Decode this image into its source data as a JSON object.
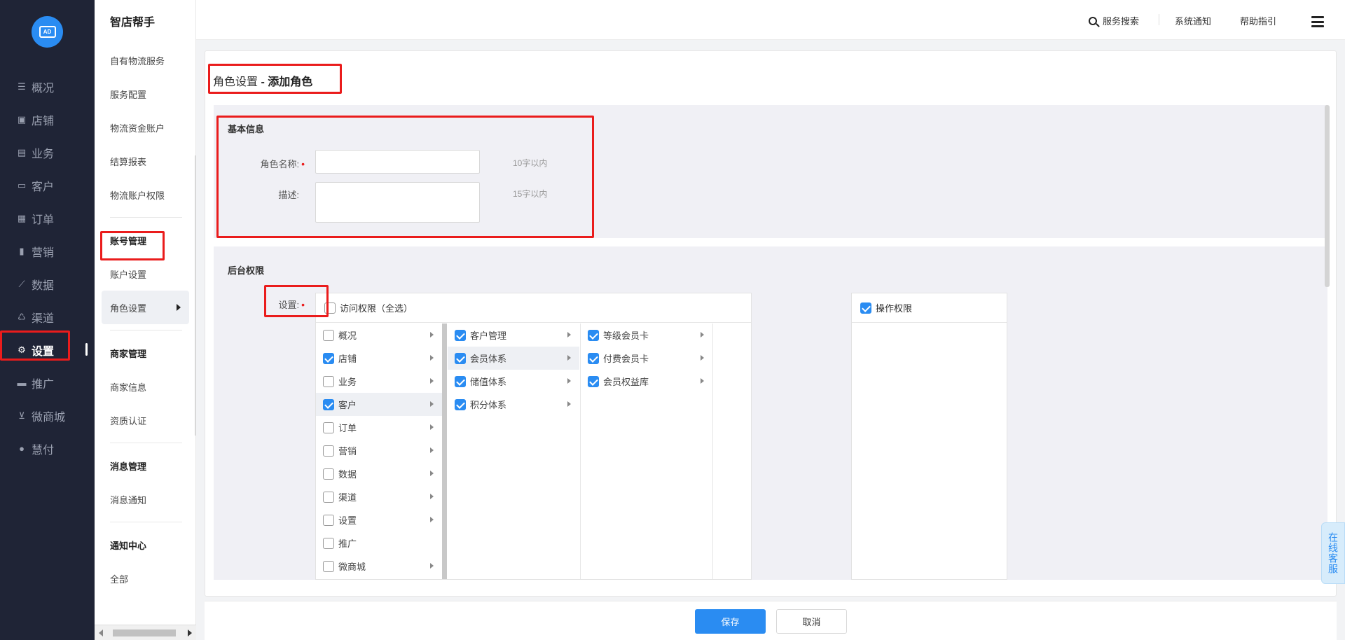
{
  "app": {
    "title": "智店帮手",
    "logo_text": "AD"
  },
  "colors": {
    "accent": "#2a8cf2",
    "sidebar_bg": "#1f2436",
    "highlight_box": "#ea1c1c"
  },
  "nav": [
    {
      "label": "概况",
      "icon": "list-icon"
    },
    {
      "label": "店铺",
      "icon": "store-icon"
    },
    {
      "label": "业务",
      "icon": "briefcase-icon"
    },
    {
      "label": "客户",
      "icon": "id-card-icon"
    },
    {
      "label": "订单",
      "icon": "document-icon"
    },
    {
      "label": "营销",
      "icon": "bar-chart-icon"
    },
    {
      "label": "数据",
      "icon": "line-chart-icon"
    },
    {
      "label": "渠道",
      "icon": "channel-icon"
    },
    {
      "label": "设置",
      "icon": "gear-icon"
    },
    {
      "label": "推广",
      "icon": "megaphone-icon"
    },
    {
      "label": "微商城",
      "icon": "cart-icon"
    },
    {
      "label": "慧付",
      "icon": "coin-icon"
    }
  ],
  "subnav": {
    "items": [
      "自有物流服务",
      "服务配置",
      "物流资金账户",
      "结算报表",
      "物流账户权限"
    ],
    "account_head": "账号管理",
    "account_items": [
      "账户设置",
      "角色设置"
    ],
    "merchant_head": "商家管理",
    "merchant_items": [
      "商家信息",
      "资质认证"
    ],
    "message_head": "消息管理",
    "message_items": [
      "消息通知"
    ],
    "notice_head": "通知中心",
    "notice_items": [
      "全部"
    ]
  },
  "topbar": {
    "search": "服务搜索",
    "notify": "系统通知",
    "help": "帮助指引"
  },
  "page": {
    "title_prefix": "角色设置",
    "title_main": " - 添加角色"
  },
  "basic": {
    "title": "基本信息",
    "name_label": "角色名称:",
    "name_hint": "10字以内",
    "desc_label": "描述:",
    "desc_hint": "15字以内"
  },
  "perm": {
    "title": "后台权限",
    "setting_label": "设置:",
    "access_all": "访问权限（全选）",
    "ops": "操作权限",
    "col1": [
      {
        "label": "概况",
        "checked": false,
        "arrow": true
      },
      {
        "label": "店铺",
        "checked": true,
        "arrow": true
      },
      {
        "label": "业务",
        "checked": false,
        "arrow": true
      },
      {
        "label": "客户",
        "checked": true,
        "arrow": true
      },
      {
        "label": "订单",
        "checked": false,
        "arrow": true
      },
      {
        "label": "营销",
        "checked": false,
        "arrow": true
      },
      {
        "label": "数据",
        "checked": false,
        "arrow": true
      },
      {
        "label": "渠道",
        "checked": false,
        "arrow": true
      },
      {
        "label": "设置",
        "checked": false,
        "arrow": true
      },
      {
        "label": "推广",
        "checked": false,
        "arrow": false
      },
      {
        "label": "微商城",
        "checked": false,
        "arrow": true
      }
    ],
    "col2": [
      {
        "label": "客户管理",
        "checked": true
      },
      {
        "label": "会员体系",
        "checked": true
      },
      {
        "label": "储值体系",
        "checked": true
      },
      {
        "label": "积分体系",
        "checked": true
      }
    ],
    "col3": [
      {
        "label": "等级会员卡",
        "checked": true
      },
      {
        "label": "付费会员卡",
        "checked": true
      },
      {
        "label": "会员权益库",
        "checked": true
      }
    ]
  },
  "footer": {
    "save": "保存",
    "cancel": "取消"
  },
  "kefu": "在线客服"
}
